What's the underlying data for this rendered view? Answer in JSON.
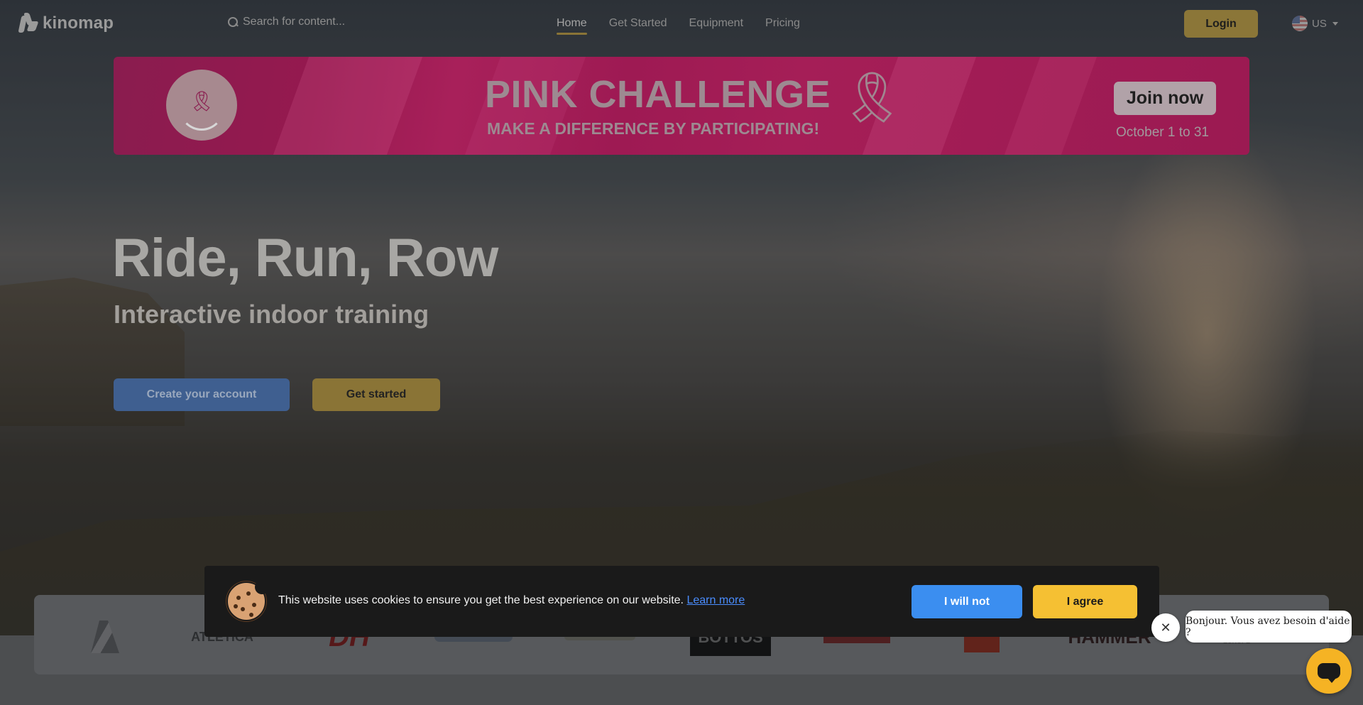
{
  "header": {
    "logo_text": "kinomap",
    "search_placeholder": "Search for content...",
    "nav": [
      {
        "label": "Home",
        "active": true
      },
      {
        "label": "Get Started",
        "active": false
      },
      {
        "label": "Equipment",
        "active": false
      },
      {
        "label": "Pricing",
        "active": false
      }
    ],
    "login_label": "Login",
    "language_label": "US",
    "language_icon": "us-flag-icon"
  },
  "banner": {
    "title": "PINK CHALLENGE",
    "subtitle": "MAKE A DIFFERENCE BY PARTICIPATING!",
    "join_label": "Join now",
    "dates": "October 1 to 31",
    "ribbon_icon": "pink-ribbon-icon"
  },
  "hero": {
    "title": "Ride, Run, Row",
    "subtitle": "Interactive indoor training",
    "create_account_label": "Create your account",
    "get_started_label": "Get started"
  },
  "partners": [
    {
      "name": "partner-logo-1",
      "text": ""
    },
    {
      "name": "partner-logo-atletica",
      "text": "ATLETICA"
    },
    {
      "name": "partner-logo-dh",
      "text": "DH"
    },
    {
      "name": "partner-logo-4",
      "text": ""
    },
    {
      "name": "partner-logo-5",
      "text": ""
    },
    {
      "name": "partner-logo-bottos",
      "text": "BOTTOS"
    },
    {
      "name": "partner-logo-7",
      "text": ""
    },
    {
      "name": "partner-logo-8",
      "text": ""
    },
    {
      "name": "partner-logo-hammer",
      "text": "HAMMER"
    },
    {
      "name": "partner-logo-europe",
      "text": "EUROPE"
    }
  ],
  "cookie": {
    "message": "This website uses cookies to ensure you get the best experience on our website.",
    "learn_more": "Learn more",
    "decline_label": "I will not",
    "agree_label": "I agree"
  },
  "chat": {
    "greeting": "Bonjour. Vous avez besoin d'aide ?",
    "close_symbol": "✕"
  },
  "colors": {
    "accent_gold": "#f5c033",
    "banner_pink": "#d81b6f",
    "primary_blue": "#3b8ef0"
  }
}
